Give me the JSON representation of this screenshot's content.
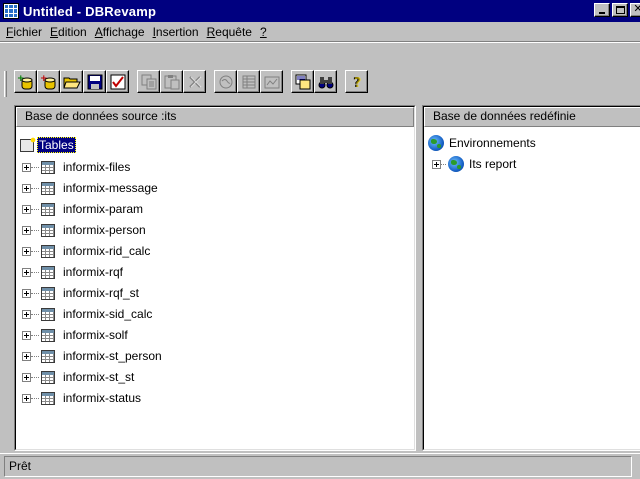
{
  "window": {
    "title": "Untitled - DBRevamp",
    "app_icon": "table-grid-icon",
    "controls": [
      "minimize-icon",
      "maximize-icon",
      "close-icon"
    ]
  },
  "menu": {
    "items": [
      {
        "label": "Fichier",
        "underline": "F"
      },
      {
        "label": "Edition",
        "underline": "E"
      },
      {
        "label": "Affichage",
        "underline": "A"
      },
      {
        "label": "Insertion",
        "underline": "I"
      },
      {
        "label": "Requête",
        "underline": "R"
      },
      {
        "label": "?",
        "underline": "?"
      }
    ]
  },
  "toolbar": {
    "buttons": [
      {
        "icon": "add-source-db-icon",
        "enabled": true
      },
      {
        "icon": "add-target-db-icon",
        "enabled": true
      },
      {
        "icon": "open-folder-icon",
        "enabled": true
      },
      {
        "icon": "save-icon",
        "enabled": true
      },
      {
        "icon": "check-icon",
        "enabled": true
      },
      {
        "icon": "copy-icon",
        "enabled": false
      },
      {
        "icon": "paste-icon",
        "enabled": false
      },
      {
        "icon": "delete-icon",
        "enabled": false
      },
      {
        "icon": "environment-icon",
        "enabled": false
      },
      {
        "icon": "table-properties-icon",
        "enabled": false
      },
      {
        "icon": "report-icon",
        "enabled": false
      },
      {
        "icon": "reorganize-icon",
        "enabled": true
      },
      {
        "icon": "binoculars-icon",
        "enabled": true
      },
      {
        "icon": "help-icon",
        "enabled": true
      }
    ]
  },
  "left_panel": {
    "header": "Base de données source :its",
    "root_label": "Tables",
    "tables": [
      "informix-files",
      "informix-message",
      "informix-param",
      "informix-person",
      "informix-rid_calc",
      "informix-rqf",
      "informix-rqf_st",
      "informix-sid_calc",
      "informix-solf",
      "informix-st_person",
      "informix-st_st",
      "informix-status"
    ]
  },
  "right_panel": {
    "header": "Base de données redéfinie",
    "root_label": "Environnements",
    "children": [
      "Its report"
    ]
  },
  "status": {
    "text": "Prêt"
  }
}
